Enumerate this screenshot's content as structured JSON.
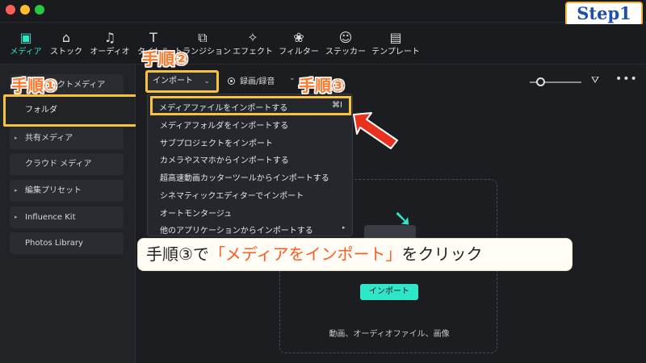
{
  "window": {
    "buttons": [
      "close",
      "minimize",
      "zoom"
    ]
  },
  "step_badge": "Step1",
  "toolbar": {
    "items": [
      {
        "label": "メディア",
        "icon": "media-icon"
      },
      {
        "label": "ストック",
        "icon": "stock-icon"
      },
      {
        "label": "オーディオ",
        "icon": "music-note-icon"
      },
      {
        "label": "タイトル",
        "icon": "title-t-icon"
      },
      {
        "label": "トランジション",
        "icon": "transition-icon"
      },
      {
        "label": "エフェクト",
        "icon": "effect-star-icon"
      },
      {
        "label": "フィルター",
        "icon": "filter-circles-icon"
      },
      {
        "label": "ステッカー",
        "icon": "sticker-icon"
      },
      {
        "label": "テンプレート",
        "icon": "template-icon"
      }
    ],
    "active_color": "#2ee6c8"
  },
  "sidebar": {
    "project_media": "プロジェクトメディア",
    "folder": "フォルダ",
    "items": [
      {
        "label": "共有メディア",
        "expandable": true
      },
      {
        "label": "クラウド メディア",
        "expandable": false
      },
      {
        "label": "編集プリセット",
        "expandable": true
      },
      {
        "label": "Influence Kit",
        "expandable": true
      },
      {
        "label": "Photos Library",
        "expandable": false
      }
    ]
  },
  "import_dropdown": {
    "label": "インポート"
  },
  "record_dropdown": {
    "label": "録画/録音"
  },
  "menu": {
    "first_item": {
      "label": "メディアファイルをインポートする",
      "shortcut": "⌘I"
    },
    "items": [
      "メディアフォルダをインポートする",
      "サブプロジェクトをインポート",
      "カメラやスマホからインポートする",
      "超高速動画カッターツールからインポートする",
      "シネマティックエディターでインポート",
      "オートモンタージュ",
      "他のアプリケーションからインポートする"
    ]
  },
  "dropzone": {
    "import_button": "インポート",
    "description": "動画、オーディオファイル、画像"
  },
  "annotations": {
    "step1": "手順①",
    "step2": "手順②",
    "step3": "手順③",
    "callout_prefix": "手順③で",
    "callout_highlight": "「メディアをインポート」",
    "callout_suffix": "をクリック",
    "highlight_color": "#f5c242",
    "label_color": "#ff7a2f"
  }
}
